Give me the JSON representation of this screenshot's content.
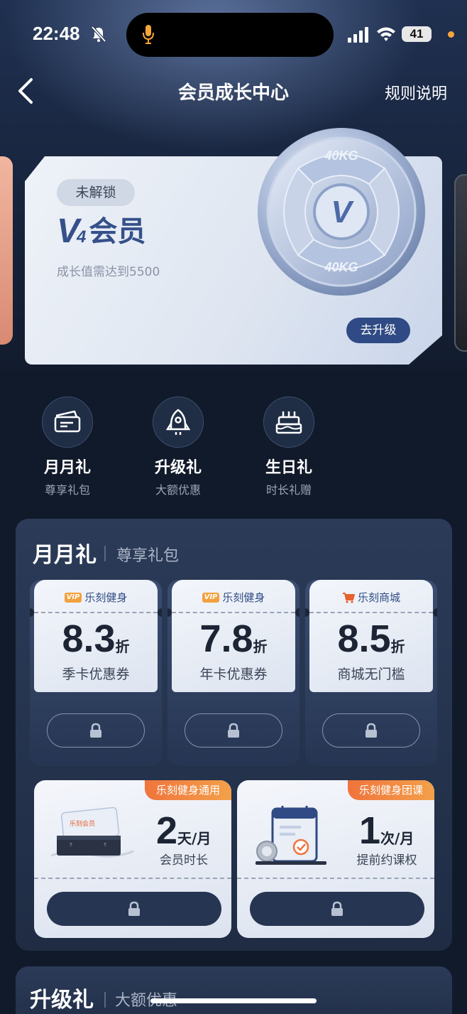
{
  "status_bar": {
    "time": "22:48",
    "battery": "41"
  },
  "nav": {
    "title": "会员成长中心",
    "rules": "规则说明"
  },
  "level_card": {
    "status": "未解锁",
    "level_mark": "V",
    "level_num": "4",
    "level_name": "会员",
    "requirement": "成长值需达到5500",
    "upgrade_button": "去升级",
    "plate_text": "40KG",
    "plate_v": "V"
  },
  "quick_tiles": [
    {
      "title": "月月礼",
      "sub": "尊享礼包",
      "icon": "ticket-icon"
    },
    {
      "title": "升级礼",
      "sub": "大额优惠",
      "icon": "rocket-icon"
    },
    {
      "title": "生日礼",
      "sub": "时长礼赠",
      "icon": "cake-icon"
    }
  ],
  "monthly": {
    "title": "月月礼",
    "subtitle": "尊享礼包",
    "coupons": [
      {
        "tag": "VIP",
        "source": "乐刻健身",
        "value": "8.3",
        "unit": "折",
        "desc": "季卡优惠券"
      },
      {
        "tag": "VIP",
        "source": "乐刻健身",
        "value": "7.8",
        "unit": "折",
        "desc": "年卡优惠券"
      },
      {
        "tag": "",
        "source": "乐刻商城",
        "value": "8.5",
        "unit": "折",
        "desc": "商城无门槛"
      }
    ],
    "big_cards": [
      {
        "tag": "乐刻健身通用",
        "value": "2",
        "unit": "天/月",
        "desc": "会员时长",
        "card_label": "乐刻会员"
      },
      {
        "tag": "乐刻健身团课",
        "value": "1",
        "unit": "次/月",
        "desc": "提前约课权"
      }
    ]
  },
  "upgrade": {
    "title": "升级礼",
    "subtitle": "大额优惠"
  },
  "colors": {
    "accent": "#2f4a84",
    "tag_orange": "#f0743c",
    "background": "#111a2a"
  }
}
